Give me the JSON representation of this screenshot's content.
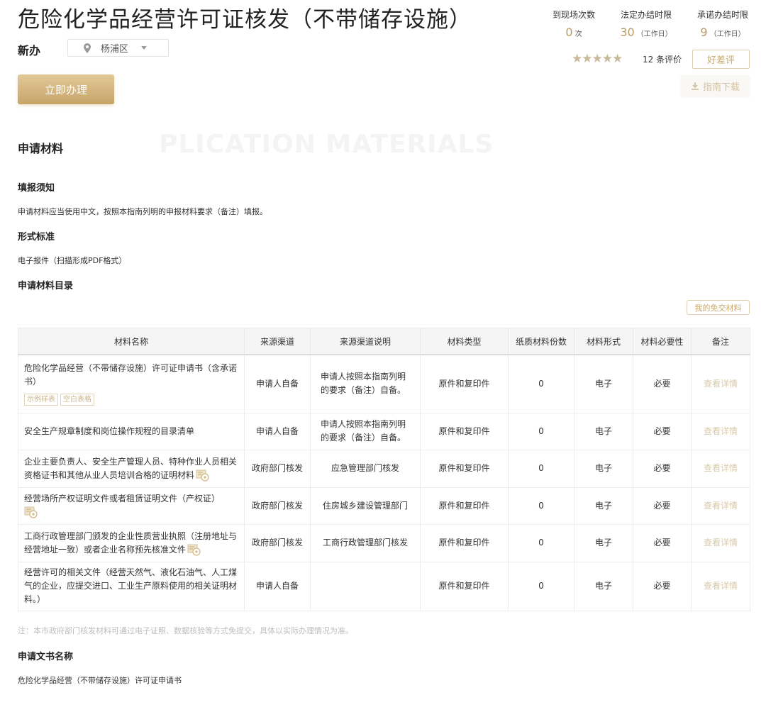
{
  "header": {
    "title": "危险化学品经营许可证核发（不带储存设施）",
    "type_label": "新办",
    "district": "杨浦区",
    "apply_button": "立即办理"
  },
  "stats": [
    {
      "label": "到现场次数",
      "value": "0",
      "unit": "次"
    },
    {
      "label": "法定办结时限",
      "value": "30",
      "unit": "（工作日）"
    },
    {
      "label": "承诺办结时限",
      "value": "9",
      "unit": "（工作日）"
    }
  ],
  "rating": {
    "stars": "★★★★★",
    "rating_value": 5,
    "count_text": "12 条评价",
    "review_button": "好差评"
  },
  "guide_download": "指南下载",
  "section": {
    "title": "申请材料",
    "watermark": "PLICATION MATERIALS",
    "fill_notice_heading": "填报须知",
    "fill_notice_text": "申请材料应当使用中文，按照本指南列明的申报材料要求（备注）填报。",
    "format_heading": "形式标准",
    "format_text": "电子报件（扫描形成PDF格式）",
    "catalog_heading": "申请材料目录",
    "exempt_button": "我的免交材料"
  },
  "table": {
    "headers": [
      "材料名称",
      "来源渠道",
      "来源渠道说明",
      "材料类型",
      "纸质材料份数",
      "材料形式",
      "材料必要性",
      "备注"
    ],
    "rows": [
      {
        "name": "危险化学品经营（不带储存设施）许可证申请书（含承诺书）",
        "tags": [
          "示例样表",
          "空白表格"
        ],
        "source": "申请人自备",
        "source_desc": "申请人按照本指南列明的要求（备注）自备。",
        "mtype": "原件和复印件",
        "copies": "0",
        "form": "电子",
        "necessity": "必要",
        "remark": "查看详情"
      },
      {
        "name": "安全生产规章制度和岗位操作规程的目录清单",
        "source": "申请人自备",
        "source_desc": "申请人按照本指南列明的要求（备注）自备。",
        "mtype": "原件和复印件",
        "copies": "0",
        "form": "电子",
        "necessity": "必要",
        "remark": "查看详情"
      },
      {
        "name": "企业主要负责人、安全生产管理人员、特种作业人员相关资格证书和其他从业人员培训合格的证明材料",
        "free": true,
        "source": "政府部门核发",
        "source_desc": "应急管理部门核发",
        "mtype": "原件和复印件",
        "copies": "0",
        "form": "电子",
        "necessity": "必要",
        "remark": "查看详情"
      },
      {
        "name": "经营场所产权证明文件或者租赁证明文件（产权证）",
        "free": true,
        "source": "政府部门核发",
        "source_desc": "住房城乡建设管理部门",
        "mtype": "原件和复印件",
        "copies": "0",
        "form": "电子",
        "necessity": "必要",
        "remark": "查看详情"
      },
      {
        "name": "工商行政管理部门颁发的企业性质营业执照（注册地址与经营地址一致）或者企业名称预先核准文件",
        "free": true,
        "source": "政府部门核发",
        "source_desc": "工商行政管理部门核发",
        "mtype": "原件和复印件",
        "copies": "0",
        "form": "电子",
        "necessity": "必要",
        "remark": "查看详情"
      },
      {
        "name": "经营许可的相关文件（经营天然气、液化石油气、人工煤气的企业，应提交进口、工业生产原料使用的相关证明材料。）",
        "source": "申请人自备",
        "source_desc": "",
        "mtype": "原件和复印件",
        "copies": "0",
        "form": "电子",
        "necessity": "必要",
        "remark": "查看详情"
      }
    ]
  },
  "note": "注：本市政府部门核发材料可通过电子证照、数据核验等方式免提交，具体以实际办理情况为准。",
  "document": {
    "heading": "申请文书名称",
    "name": "危险化学品经营（不带储存设施）许可证申请书"
  },
  "colors": {
    "gold": "#c9a86c",
    "gold_light": "#d9c9a8",
    "button_gradient_top": "#e2c999",
    "button_gradient_bottom": "#c6a469"
  },
  "icons": {
    "district": "location-pin-icon",
    "dropdown": "chevron-down-icon",
    "download": "download-icon",
    "free": "exempt-badge-icon"
  }
}
